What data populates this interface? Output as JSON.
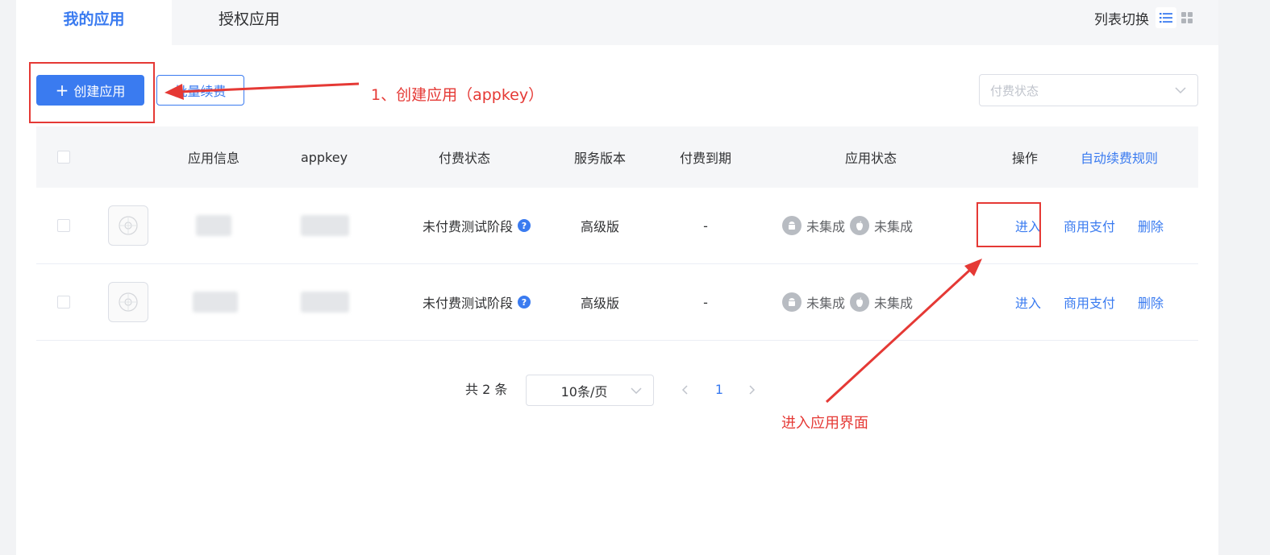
{
  "tabs": [
    {
      "label": "我的应用",
      "active": true
    },
    {
      "label": "授权应用",
      "active": false
    }
  ],
  "view_switch": {
    "label": "列表切换"
  },
  "toolbar": {
    "create_button": "创建应用",
    "batch_button": "批量续费",
    "pay_status_placeholder": "付费状态"
  },
  "table": {
    "headers": {
      "info": "应用信息",
      "appkey": "appkey",
      "pay_status": "付费状态",
      "service_version": "服务版本",
      "expiry": "付费到期",
      "app_status": "应用状态",
      "actions": "操作",
      "auto_renew_rule": "自动续费规则"
    },
    "rows": [
      {
        "pay_status": "未付费测试阶段",
        "service_version": "高级版",
        "expiry": "-",
        "android_status": "未集成",
        "ios_status": "未集成",
        "action_enter": "进入",
        "action_pay": "商用支付",
        "action_delete": "删除"
      },
      {
        "pay_status": "未付费测试阶段",
        "service_version": "高级版",
        "expiry": "-",
        "android_status": "未集成",
        "ios_status": "未集成",
        "action_enter": "进入",
        "action_pay": "商用支付",
        "action_delete": "删除"
      }
    ]
  },
  "pagination": {
    "total_text": "共 2 条",
    "page_size": "10条/页",
    "current_page": "1"
  },
  "annotations": {
    "create_hint": "1、创建应用（appkey）",
    "enter_hint": "进入应用界面",
    "color": "#e53935"
  },
  "colors": {
    "accent": "#3a7bf0",
    "annotation": "#e53935"
  }
}
